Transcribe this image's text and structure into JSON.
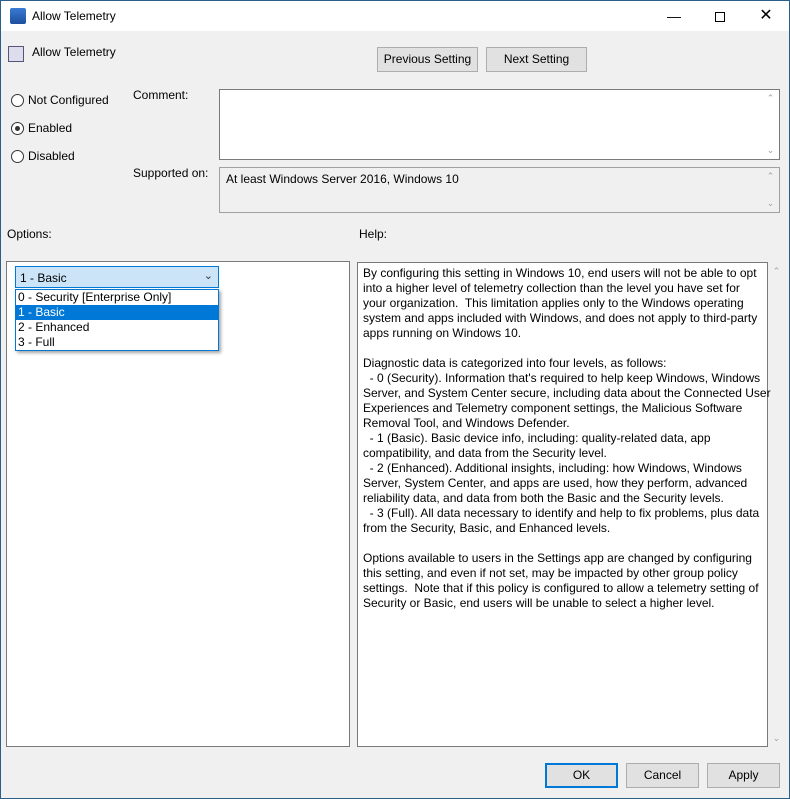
{
  "window": {
    "title": "Allow Telemetry",
    "controls": [
      "minimize",
      "maximize",
      "close"
    ]
  },
  "header": {
    "policy_name": "Allow Telemetry",
    "prev_label": "Previous Setting",
    "next_label": "Next Setting"
  },
  "state": {
    "options": [
      "Not Configured",
      "Enabled",
      "Disabled"
    ],
    "selected": "Enabled"
  },
  "comment": {
    "label": "Comment:",
    "value": ""
  },
  "supported": {
    "label": "Supported on:",
    "value": "At least Windows Server 2016, Windows 10"
  },
  "options_label": "Options:",
  "help_label": "Help:",
  "dropdown": {
    "value": "1 - Basic",
    "items": [
      "0 - Security [Enterprise Only]",
      "1 - Basic",
      "2 - Enhanced",
      "3 - Full"
    ],
    "highlighted": "1 - Basic"
  },
  "help_lines": [
    "By configuring this setting in Windows 10, end users will not be able to opt",
    "into a higher level of telemetry collection than the level you have set for",
    "your organization.  This limitation applies only to the Windows operating",
    "system and apps included with Windows, and does not apply to third-party",
    "apps running on Windows 10.",
    "",
    "Diagnostic data is categorized into four levels, as follows:",
    "  - 0 (Security). Information that's required to help keep Windows, Windows",
    "Server, and System Center secure, including data about the Connected User",
    "Experiences and Telemetry component settings, the Malicious Software",
    "Removal Tool, and Windows Defender.",
    "  - 1 (Basic). Basic device info, including: quality-related data, app",
    "compatibility, and data from the Security level.",
    "  - 2 (Enhanced). Additional insights, including: how Windows, Windows",
    "Server, System Center, and apps are used, how they perform, advanced",
    "reliability data, and data from both the Basic and the Security levels.",
    "  - 3 (Full). All data necessary to identify and help to fix problems, plus data",
    "from the Security, Basic, and Enhanced levels.",
    "",
    "Options available to users in the Settings app are changed by configuring",
    "this setting, and even if not set, may be impacted by other group policy",
    "settings.  Note that if this policy is configured to allow a telemetry setting of",
    "Security or Basic, end users will be unable to select a higher level."
  ],
  "footer": {
    "ok": "OK",
    "cancel": "Cancel",
    "apply": "Apply"
  },
  "colors": {
    "accent": "#0078d7",
    "dropdown_bg": "#cce4f7"
  }
}
